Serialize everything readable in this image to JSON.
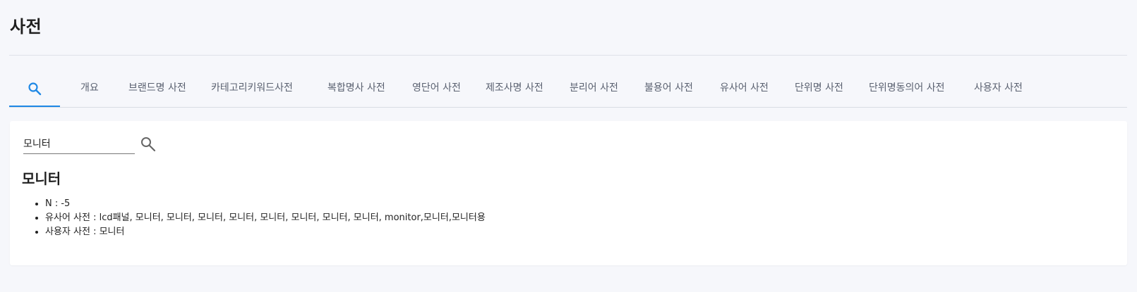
{
  "page": {
    "title": "사전"
  },
  "tabs": {
    "search_icon": "search-icon",
    "items": [
      {
        "label": "개요"
      },
      {
        "label": "브랜드명 사전"
      },
      {
        "label": "카테고리키워드사전"
      },
      {
        "label": "복합명사 사전"
      },
      {
        "label": "영단어 사전"
      },
      {
        "label": "제조사명 사전"
      },
      {
        "label": "분리어 사전"
      },
      {
        "label": "불용어 사전"
      },
      {
        "label": "유사어 사전"
      },
      {
        "label": "단위명 사전"
      },
      {
        "label": "단위명동의어 사전"
      },
      {
        "label": "사용자 사전"
      }
    ]
  },
  "search": {
    "value": "모니터",
    "button_icon": "search-icon"
  },
  "result": {
    "title": "모니터",
    "items": [
      "N : -5",
      "유사어 사전 : lcd패널, 모니터, 모니터, 모니터, 모니터, 모니터, 모니터, 모니터, 모니터, monitor,모니터,모니터용",
      "사용자 사전 : 모니터"
    ]
  },
  "colors": {
    "accent": "#1e88e5",
    "background": "#f6f7fb",
    "card": "#ffffff"
  }
}
